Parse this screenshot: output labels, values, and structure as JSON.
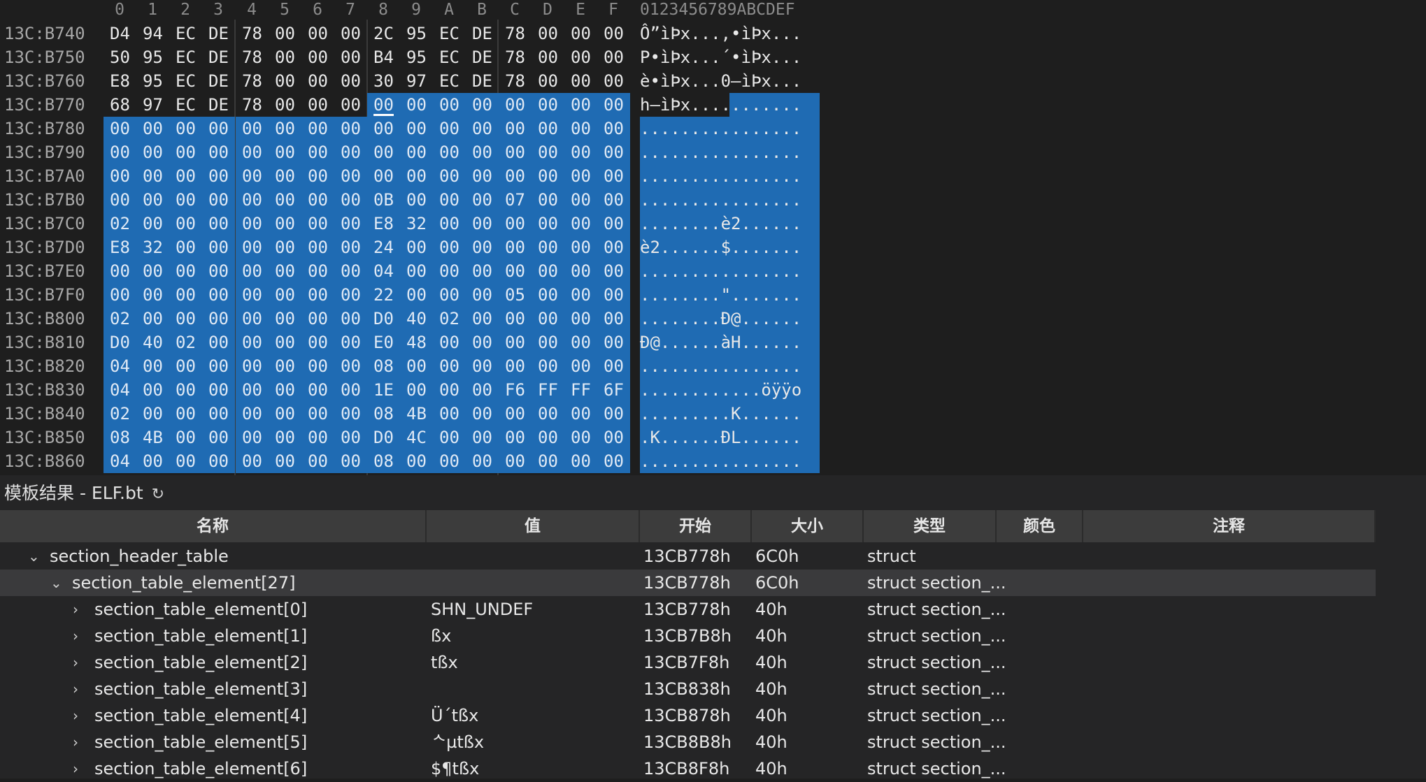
{
  "hex": {
    "col_headers": [
      "0",
      "1",
      "2",
      "3",
      "4",
      "5",
      "6",
      "7",
      "8",
      "9",
      "A",
      "B",
      "C",
      "D",
      "E",
      "F"
    ],
    "ascii_header": "0123456789ABCDEF",
    "rows": [
      {
        "addr": "13C:B740",
        "bytes": [
          "D4",
          "94",
          "EC",
          "DE",
          "78",
          "00",
          "00",
          "00",
          "2C",
          "95",
          "EC",
          "DE",
          "78",
          "00",
          "00",
          "00"
        ],
        "ascii": "Ô”ìÞx...,•ìÞx..."
      },
      {
        "addr": "13C:B750",
        "bytes": [
          "50",
          "95",
          "EC",
          "DE",
          "78",
          "00",
          "00",
          "00",
          "B4",
          "95",
          "EC",
          "DE",
          "78",
          "00",
          "00",
          "00"
        ],
        "ascii": "P•ìÞx...´•ìÞx..."
      },
      {
        "addr": "13C:B760",
        "bytes": [
          "E8",
          "95",
          "EC",
          "DE",
          "78",
          "00",
          "00",
          "00",
          "30",
          "97",
          "EC",
          "DE",
          "78",
          "00",
          "00",
          "00"
        ],
        "ascii": "è•ìÞx...0—ìÞx..."
      },
      {
        "addr": "13C:B770",
        "bytes": [
          "68",
          "97",
          "EC",
          "DE",
          "78",
          "00",
          "00",
          "00",
          "00",
          "00",
          "00",
          "00",
          "00",
          "00",
          "00",
          "00"
        ],
        "ascii": "h—ìÞx..........."
      },
      {
        "addr": "13C:B780",
        "bytes": [
          "00",
          "00",
          "00",
          "00",
          "00",
          "00",
          "00",
          "00",
          "00",
          "00",
          "00",
          "00",
          "00",
          "00",
          "00",
          "00"
        ],
        "ascii": "................"
      },
      {
        "addr": "13C:B790",
        "bytes": [
          "00",
          "00",
          "00",
          "00",
          "00",
          "00",
          "00",
          "00",
          "00",
          "00",
          "00",
          "00",
          "00",
          "00",
          "00",
          "00"
        ],
        "ascii": "................"
      },
      {
        "addr": "13C:B7A0",
        "bytes": [
          "00",
          "00",
          "00",
          "00",
          "00",
          "00",
          "00",
          "00",
          "00",
          "00",
          "00",
          "00",
          "00",
          "00",
          "00",
          "00"
        ],
        "ascii": "................"
      },
      {
        "addr": "13C:B7B0",
        "bytes": [
          "00",
          "00",
          "00",
          "00",
          "00",
          "00",
          "00",
          "00",
          "0B",
          "00",
          "00",
          "00",
          "07",
          "00",
          "00",
          "00"
        ],
        "ascii": "................"
      },
      {
        "addr": "13C:B7C0",
        "bytes": [
          "02",
          "00",
          "00",
          "00",
          "00",
          "00",
          "00",
          "00",
          "E8",
          "32",
          "00",
          "00",
          "00",
          "00",
          "00",
          "00"
        ],
        "ascii": "........è2......"
      },
      {
        "addr": "13C:B7D0",
        "bytes": [
          "E8",
          "32",
          "00",
          "00",
          "00",
          "00",
          "00",
          "00",
          "24",
          "00",
          "00",
          "00",
          "00",
          "00",
          "00",
          "00"
        ],
        "ascii": "è2......$......."
      },
      {
        "addr": "13C:B7E0",
        "bytes": [
          "00",
          "00",
          "00",
          "00",
          "00",
          "00",
          "00",
          "00",
          "04",
          "00",
          "00",
          "00",
          "00",
          "00",
          "00",
          "00"
        ],
        "ascii": "................"
      },
      {
        "addr": "13C:B7F0",
        "bytes": [
          "00",
          "00",
          "00",
          "00",
          "00",
          "00",
          "00",
          "00",
          "22",
          "00",
          "00",
          "00",
          "05",
          "00",
          "00",
          "00"
        ],
        "ascii": "........\"......."
      },
      {
        "addr": "13C:B800",
        "bytes": [
          "02",
          "00",
          "00",
          "00",
          "00",
          "00",
          "00",
          "00",
          "D0",
          "40",
          "02",
          "00",
          "00",
          "00",
          "00",
          "00"
        ],
        "ascii": "........Ð@......"
      },
      {
        "addr": "13C:B810",
        "bytes": [
          "D0",
          "40",
          "02",
          "00",
          "00",
          "00",
          "00",
          "00",
          "E0",
          "48",
          "00",
          "00",
          "00",
          "00",
          "00",
          "00"
        ],
        "ascii": "Ð@......àH......"
      },
      {
        "addr": "13C:B820",
        "bytes": [
          "04",
          "00",
          "00",
          "00",
          "00",
          "00",
          "00",
          "00",
          "08",
          "00",
          "00",
          "00",
          "00",
          "00",
          "00",
          "00"
        ],
        "ascii": "................"
      },
      {
        "addr": "13C:B830",
        "bytes": [
          "04",
          "00",
          "00",
          "00",
          "00",
          "00",
          "00",
          "00",
          "1E",
          "00",
          "00",
          "00",
          "F6",
          "FF",
          "FF",
          "6F"
        ],
        "ascii": "............öÿÿo"
      },
      {
        "addr": "13C:B840",
        "bytes": [
          "02",
          "00",
          "00",
          "00",
          "00",
          "00",
          "00",
          "00",
          "08",
          "4B",
          "00",
          "00",
          "00",
          "00",
          "00",
          "00"
        ],
        "ascii": ".........K......"
      },
      {
        "addr": "13C:B850",
        "bytes": [
          "08",
          "4B",
          "00",
          "00",
          "00",
          "00",
          "00",
          "00",
          "D0",
          "4C",
          "00",
          "00",
          "00",
          "00",
          "00",
          "00"
        ],
        "ascii": ".K......ÐL......"
      },
      {
        "addr": "13C:B860",
        "bytes": [
          "04",
          "00",
          "00",
          "00",
          "00",
          "00",
          "00",
          "00",
          "08",
          "00",
          "00",
          "00",
          "00",
          "00",
          "00",
          "00"
        ],
        "ascii": "................"
      }
    ]
  },
  "panel": {
    "title": "模板结果 - ELF.bt",
    "refresh_icon": "↻",
    "columns": [
      "名称",
      "值",
      "开始",
      "大小",
      "类型",
      "颜色",
      "注释"
    ],
    "rows": [
      {
        "chev": "⌄",
        "name": "section_header_table",
        "value": "",
        "start": "13CB778h",
        "size": "6C0h",
        "type": "struct"
      },
      {
        "chev": "⌄",
        "name": "section_table_element[27]",
        "value": "",
        "start": "13CB778h",
        "size": "6C0h",
        "type": "struct section_..."
      },
      {
        "chev": "›",
        "name": "section_table_element[0]",
        "value": "SHN_UNDEF",
        "start": "13CB778h",
        "size": "40h",
        "type": "struct section_..."
      },
      {
        "chev": "›",
        "name": "section_table_element[1]",
        "value": "ßx",
        "start": "13CB7B8h",
        "size": "40h",
        "type": "struct section_..."
      },
      {
        "chev": "›",
        "name": "section_table_element[2]",
        "value": "tßx",
        "start": "13CB7F8h",
        "size": "40h",
        "type": "struct section_..."
      },
      {
        "chev": "›",
        "name": "section_table_element[3]",
        "value": "",
        "start": "13CB838h",
        "size": "40h",
        "type": "struct section_..."
      },
      {
        "chev": "›",
        "name": "section_table_element[4]",
        "value": "Ü´tßx",
        "start": "13CB878h",
        "size": "40h",
        "type": "struct section_..."
      },
      {
        "chev": "›",
        "name": "section_table_element[5]",
        "value": "ᄾµtßx",
        "start": "13CB8B8h",
        "size": "40h",
        "type": "struct section_..."
      },
      {
        "chev": "›",
        "name": "section_table_element[6]",
        "value": "$¶tßx",
        "start": "13CB8F8h",
        "size": "40h",
        "type": "struct section_..."
      }
    ]
  }
}
